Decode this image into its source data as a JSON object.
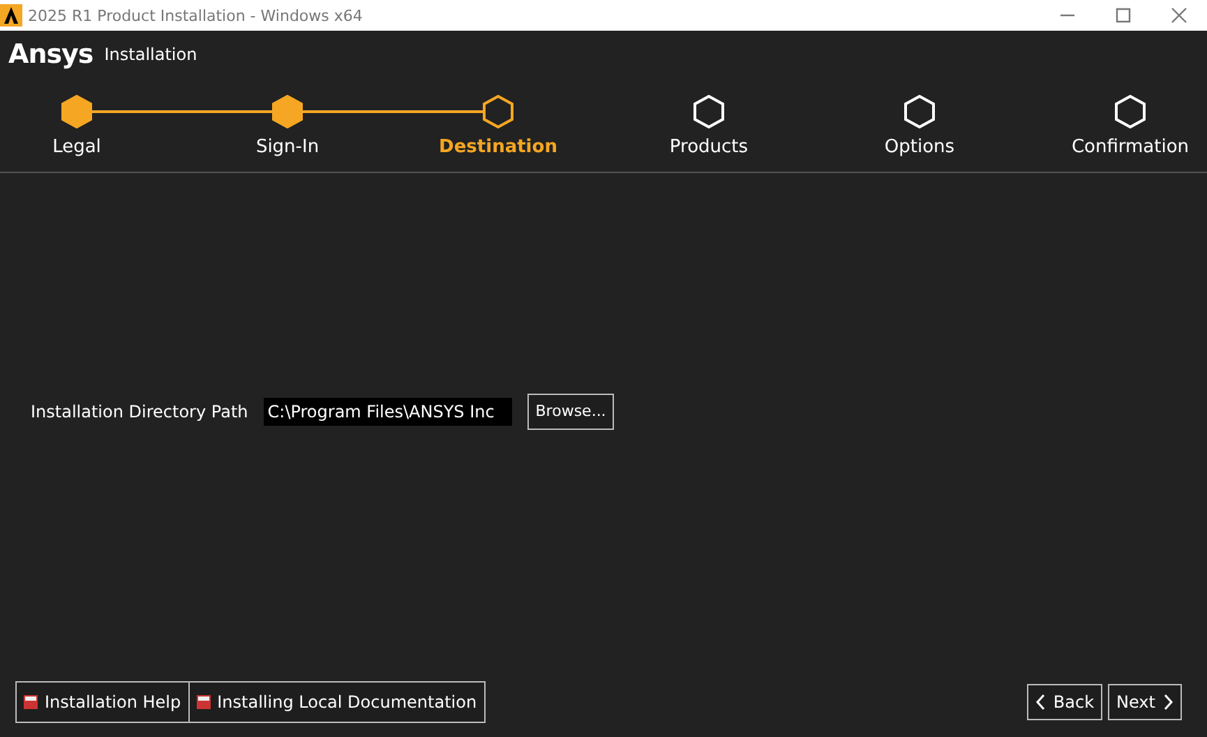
{
  "window": {
    "title": "2025 R1 Product Installation - Windows x64"
  },
  "header": {
    "logo": "Ansys",
    "subtitle": "Installation"
  },
  "steps": [
    {
      "label": "Legal",
      "completed": true,
      "selected": false
    },
    {
      "label": "Sign-In",
      "completed": true,
      "selected": false
    },
    {
      "label": "Destination",
      "completed": false,
      "selected": true
    },
    {
      "label": "Products",
      "completed": false,
      "selected": false
    },
    {
      "label": "Options",
      "completed": false,
      "selected": false
    },
    {
      "label": "Confirmation",
      "completed": false,
      "selected": false
    }
  ],
  "directory": {
    "label": "Installation Directory Path",
    "value": "C:\\Program Files\\ANSYS Inc",
    "browse": "Browse..."
  },
  "help_buttons": [
    "Installation Help",
    "Installing Local Documentation"
  ],
  "nav": {
    "back": "Back",
    "next": "Next"
  }
}
